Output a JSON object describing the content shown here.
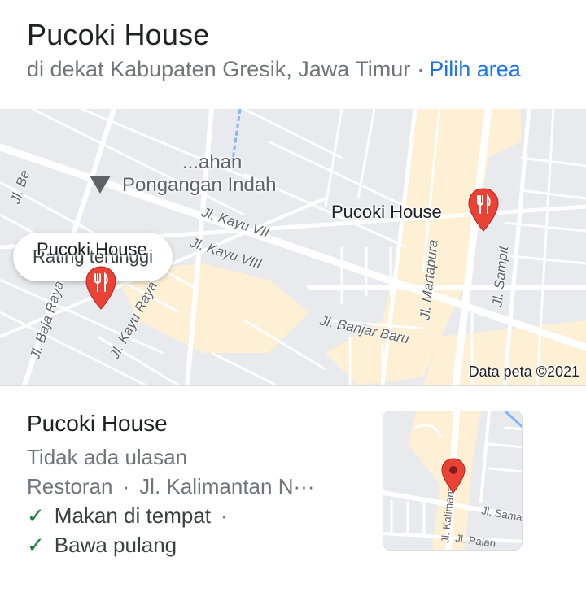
{
  "header": {
    "title": "Pucoki House",
    "location": "di dekat Kabupaten Gresik, Jawa Timur",
    "separator": "·",
    "area_link": "Pilih area"
  },
  "map": {
    "chip_label": "Rating tertinggi",
    "area_label_1": "...ahan",
    "area_label_2": "Pongangan Indah",
    "pin_labels": [
      "Pucoki House",
      "Pucoki House"
    ],
    "streets": {
      "kayu_vii": "Jl. Kayu VII",
      "kayu_viii": "Jl. Kayu VIII",
      "kayu_raya": "Jl. Kayu Raya",
      "baja_raya": "Jl. Baja Raya",
      "be": "Jl. Be",
      "banjar_baru": "Jl. Banjar Baru",
      "martapura": "Jl. Martapura",
      "sampit": "Jl. Sampit"
    },
    "copyright": "Data peta ©2021",
    "pin_color": "#ea4335"
  },
  "result": {
    "name": "Pucoki House",
    "reviews": "Tidak ada ulasan",
    "category": "Restoran",
    "separator": "·",
    "address": "Jl. Kalimantan N···",
    "services": [
      {
        "label": "Makan di tempat",
        "suffix": "·"
      },
      {
        "label": "Bawa pulang",
        "suffix": ""
      }
    ],
    "thumb_streets": {
      "kalimantan": "Jl. Kalimantan",
      "sama": "Jl. Sama",
      "palan": "Jl. Palan"
    }
  }
}
